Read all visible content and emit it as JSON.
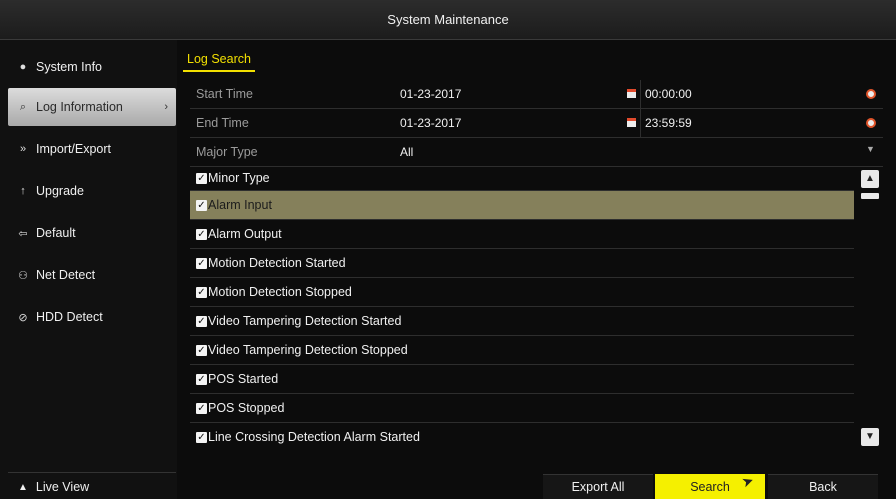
{
  "window": {
    "title": "System Maintenance"
  },
  "sidebar": {
    "items": [
      {
        "label": "System Info",
        "icon": "info-icon"
      },
      {
        "label": "Log Information",
        "icon": "log-search-icon",
        "active": true
      },
      {
        "label": "Import/Export",
        "icon": "import-export-icon"
      },
      {
        "label": "Upgrade",
        "icon": "upgrade-icon"
      },
      {
        "label": "Default",
        "icon": "default-icon"
      },
      {
        "label": "Net Detect",
        "icon": "network-icon"
      },
      {
        "label": "HDD Detect",
        "icon": "hdd-icon"
      }
    ],
    "live_view": "Live View"
  },
  "tabs": [
    {
      "label": "Log Search",
      "active": true
    }
  ],
  "form": {
    "start_time": {
      "label": "Start Time",
      "date": "01-23-2017",
      "time": "00:00:00"
    },
    "end_time": {
      "label": "End Time",
      "date": "01-23-2017",
      "time": "23:59:59"
    },
    "major_type": {
      "label": "Major Type",
      "value": "All"
    }
  },
  "minor_type": {
    "header": "Minor Type",
    "items": [
      {
        "label": "Alarm Input",
        "checked": true,
        "selected": true
      },
      {
        "label": "Alarm Output",
        "checked": true
      },
      {
        "label": "Motion Detection Started",
        "checked": true
      },
      {
        "label": "Motion Detection Stopped",
        "checked": true
      },
      {
        "label": "Video Tampering Detection Started",
        "checked": true
      },
      {
        "label": "Video Tampering Detection Stopped",
        "checked": true
      },
      {
        "label": "POS Started",
        "checked": true
      },
      {
        "label": "POS Stopped",
        "checked": true
      },
      {
        "label": "Line Crossing Detection Alarm Started",
        "checked": true
      }
    ]
  },
  "footer": {
    "export_all": "Export All",
    "search": "Search",
    "back": "Back"
  },
  "colors": {
    "accent": "#f5f000",
    "selected_row": "#85805b",
    "background": "#0c0c0c"
  }
}
